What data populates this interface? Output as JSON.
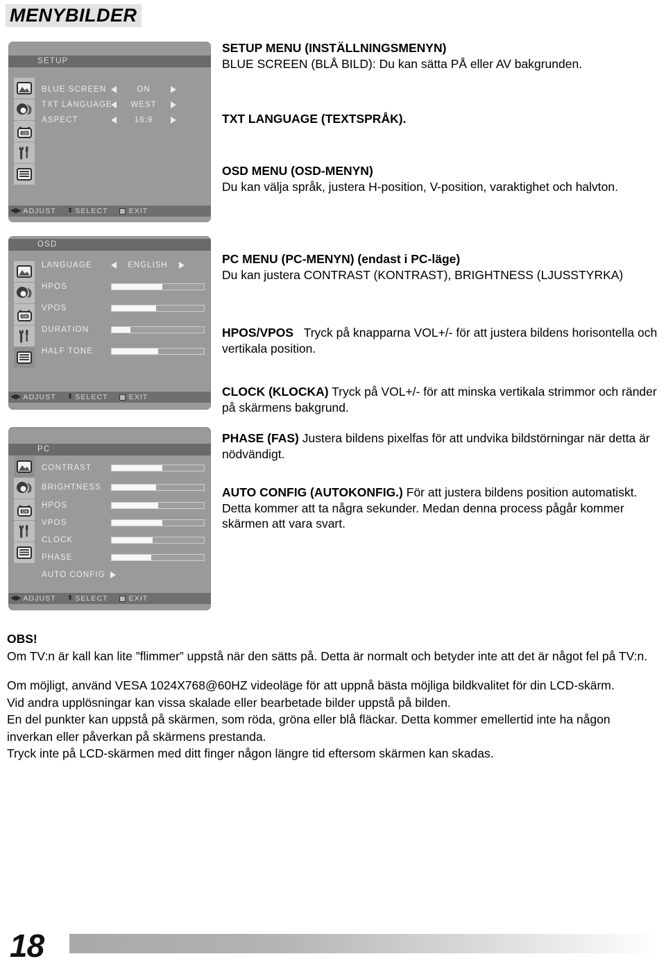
{
  "page": {
    "heading": "MENYBILDER",
    "number": "18"
  },
  "menus": [
    {
      "id": "setup",
      "title": "SETUP",
      "active_icon_index": 3,
      "rows": [
        {
          "label": "BLUE SCREEN",
          "value": "ON",
          "type": "arrows"
        },
        {
          "label": "TXT LANGUAGE",
          "value": "WEST",
          "type": "arrows"
        },
        {
          "label": "ASPECT",
          "value": "16:9",
          "type": "arrows"
        }
      ],
      "footer": {
        "adjust": "ADJUST",
        "select": "SELECT",
        "exit": "EXIT"
      }
    },
    {
      "id": "osd",
      "title": "OSD",
      "active_icon_index": 4,
      "rows": [
        {
          "label": "LANGUAGE",
          "value": "ENGLISH",
          "type": "arrows"
        },
        {
          "label": "HPOS",
          "type": "slider",
          "fill": 55
        },
        {
          "label": "VPOS",
          "type": "slider",
          "fill": 48
        },
        {
          "label": "DURATION",
          "type": "slider",
          "fill": 20
        },
        {
          "label": "HALF TONE",
          "type": "slider",
          "fill": 50
        }
      ],
      "footer": {
        "adjust": "ADJUST",
        "select": "SELECT",
        "exit": "EXIT"
      }
    },
    {
      "id": "pc",
      "title": "PC",
      "active_icon_index": 0,
      "rows": [
        {
          "label": "CONTRAST",
          "type": "slider",
          "fill": 55
        },
        {
          "label": "BRIGHTNESS",
          "type": "slider",
          "fill": 48
        },
        {
          "label": "HPOS",
          "type": "slider",
          "fill": 50
        },
        {
          "label": "VPOS",
          "type": "slider",
          "fill": 55
        },
        {
          "label": "CLOCK",
          "type": "slider",
          "fill": 44
        },
        {
          "label": "PHASE",
          "type": "slider",
          "fill": 43
        },
        {
          "label": "AUTO CONFIG",
          "type": "action"
        }
      ],
      "footer": {
        "adjust": "ADJUST",
        "select": "SELECT",
        "exit": "EXIT"
      }
    }
  ],
  "icons": [
    {
      "name": "picture-icon",
      "label": "Picture"
    },
    {
      "name": "sound-icon",
      "label": "Sound"
    },
    {
      "name": "channel-icon",
      "label": "Channel"
    },
    {
      "name": "tools-icon",
      "label": "Setup"
    },
    {
      "name": "osd-list-icon",
      "label": "OSD"
    }
  ],
  "body": {
    "setup_heading": "SETUP MENU (INSTÄLLNINGSMENYN)",
    "setup_text": "BLUE SCREEN (BLÅ BILD): Du kan sätta PÅ eller AV bakgrunden.",
    "txt_language_heading": "TXT LANGUAGE (TEXTSPRÅK).",
    "osd_heading": "OSD MENU (OSD-MENYN)",
    "osd_text": "Du kan välja språk, justera H-position, V-position, varaktighet och halvton.",
    "pc_heading": "PC MENU (PC-MENYN) (endast i PC-läge)",
    "pc_text": "Du kan justera CONTRAST (KONTRAST), BRIGHTNESS (LJUSSTYRKA)",
    "hposvpos_heading": "HPOS/VPOS",
    "hposvpos_text": "Tryck på knapparna VOL+/- för att justera bildens horisontella och vertikala position.",
    "clock_heading": "CLOCK (KLOCKA)",
    "clock_text": "Tryck på VOL+/- för att minska vertikala strimmor och ränder på skärmens bakgrund.",
    "phase_heading": "PHASE (FAS)",
    "phase_text": "Justera bildens pixelfas för att undvika bildstörningar när detta är nödvändigt.",
    "autoconfig_heading": "AUTO CONFIG (AUTOKONFIG.)",
    "autoconfig_text": "För att justera bildens position automatiskt. Detta kommer att ta några sekunder. Medan denna process pågår kommer skärmen att vara svart."
  },
  "notes": {
    "heading": "OBS!",
    "line1": "Om TV:n är kall kan lite ”flimmer” uppstå när den sätts på. Detta är normalt och betyder inte att det är något fel på TV:n.",
    "line2": "Om möjligt, använd VESA 1024X768@60HZ videoläge för att uppnå bästa möjliga bildkvalitet för din LCD-skärm.",
    "line3": "Vid andra upplösningar kan vissa skalade eller bearbetade bilder uppstå på bilden.",
    "line4": "En del punkter kan uppstå på skärmen, som röda, gröna eller blå fläckar. Detta kommer emellertid inte ha någon inverkan eller påverkan på skärmens prestanda.",
    "line5": "Tryck inte på LCD-skärmen med ditt finger någon längre tid eftersom skärmen kan skadas."
  }
}
